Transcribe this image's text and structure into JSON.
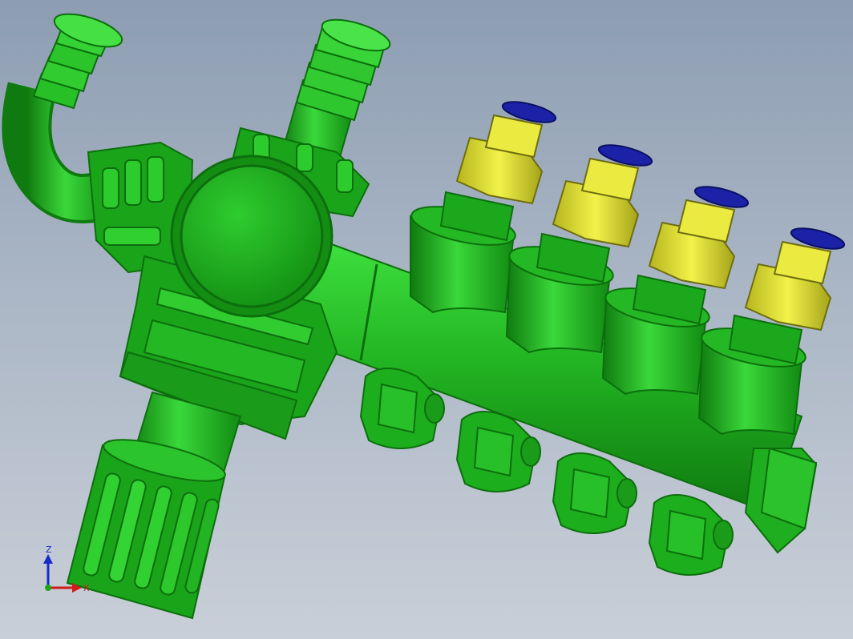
{
  "viewport": {
    "background_top": "#8d9db2",
    "background_bottom": "#c9cfd8"
  },
  "colors": {
    "green_dark": "#0f7a0f",
    "green_mid": "#22b422",
    "green_light": "#4ee84e",
    "yellow": "#e7e73a",
    "yellow_dark": "#b6b51e",
    "blue_cap": "#1b22a8"
  },
  "model": {
    "name": "",
    "parts": [
      "hose-barb-elbow",
      "hose-barb-straight",
      "valve-body",
      "valve-cap",
      "manifold-tube",
      "manifold-risers",
      "push-fittings",
      "bottom-connectors",
      "end-plug",
      "knurled-knob"
    ],
    "riser_count": 4,
    "bottom_connector_count": 4
  },
  "triad": {
    "z_label": "Z",
    "x_label": "X",
    "z_color": "#1a2cc8",
    "x_color": "#d41a1a",
    "y_color": "#1aa81a"
  }
}
